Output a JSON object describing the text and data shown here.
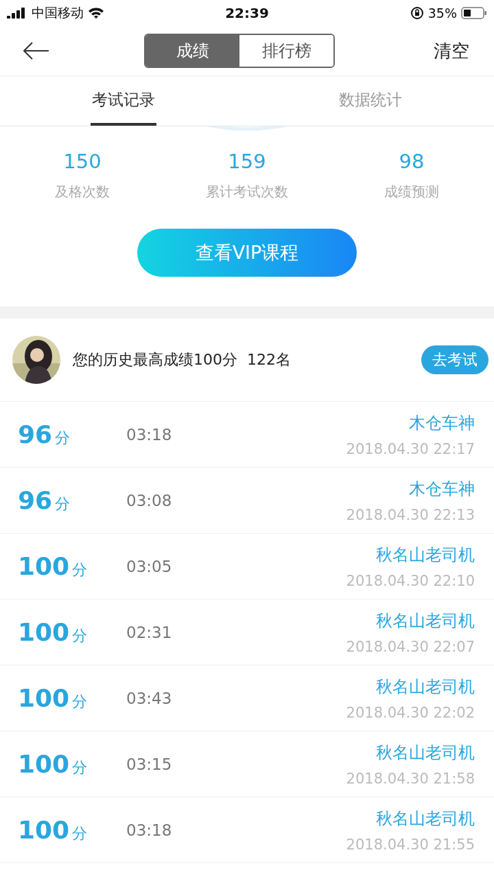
{
  "status_bar": {
    "carrier": "中国移动",
    "time": "22:39",
    "battery_percent": "35%"
  },
  "nav": {
    "segments": [
      {
        "label": "成绩",
        "selected": true
      },
      {
        "label": "排行榜",
        "selected": false
      }
    ],
    "action": "清空"
  },
  "tabs": [
    {
      "label": "考试记录",
      "selected": true
    },
    {
      "label": "数据统计",
      "selected": false
    }
  ],
  "stats": [
    {
      "value": "150",
      "label": "及格次数"
    },
    {
      "value": "159",
      "label": "累计考试次数"
    },
    {
      "value": "98",
      "label": "成绩预测"
    }
  ],
  "vip_button": "查看VIP课程",
  "best": {
    "text": "您的历史最高成绩100分  122名",
    "button": "去考试"
  },
  "records": [
    {
      "score": "96",
      "unit": "分",
      "duration": "03:18",
      "name": "木仓车神",
      "datetime": "2018.04.30 22:17"
    },
    {
      "score": "96",
      "unit": "分",
      "duration": "03:08",
      "name": "木仓车神",
      "datetime": "2018.04.30 22:13"
    },
    {
      "score": "100",
      "unit": "分",
      "duration": "03:05",
      "name": "秋名山老司机",
      "datetime": "2018.04.30 22:10"
    },
    {
      "score": "100",
      "unit": "分",
      "duration": "02:31",
      "name": "秋名山老司机",
      "datetime": "2018.04.30 22:07"
    },
    {
      "score": "100",
      "unit": "分",
      "duration": "03:43",
      "name": "秋名山老司机",
      "datetime": "2018.04.30 22:02"
    },
    {
      "score": "100",
      "unit": "分",
      "duration": "03:15",
      "name": "秋名山老司机",
      "datetime": "2018.04.30 21:58"
    },
    {
      "score": "100",
      "unit": "分",
      "duration": "03:18",
      "name": "秋名山老司机",
      "datetime": "2018.04.30 21:55"
    }
  ]
}
